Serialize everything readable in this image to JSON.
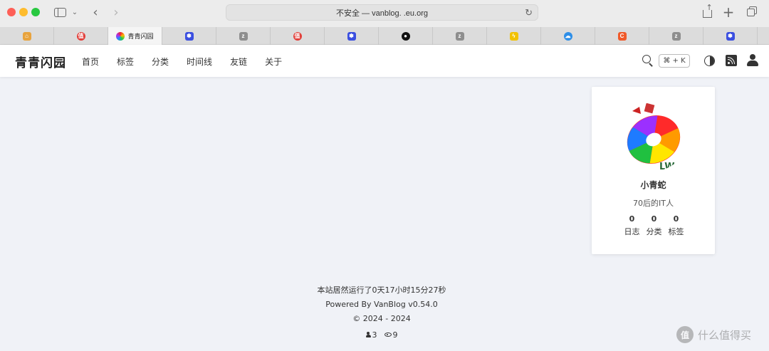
{
  "browser": {
    "url": "不安全 — vanblog.        .eu.org",
    "tabs": [
      {
        "title": "",
        "icon": "home-favicon",
        "color": "#e8a33d"
      },
      {
        "title": "",
        "icon": "smzdm-favicon",
        "color": "#e23f3a"
      },
      {
        "title": "青青闪园",
        "icon": "site-favicon",
        "color": "#6a5acd",
        "active": true
      },
      {
        "title": "",
        "icon": "paw-favicon",
        "color": "#3b4fe0"
      },
      {
        "title": "",
        "icon": "z-favicon",
        "color": "#8e8e8e"
      },
      {
        "title": "",
        "icon": "smzdm-favicon",
        "color": "#e23f3a"
      },
      {
        "title": "",
        "icon": "paw-favicon",
        "color": "#3b4fe0"
      },
      {
        "title": "",
        "icon": "github-favicon",
        "color": "#111111"
      },
      {
        "title": "",
        "icon": "z-favicon",
        "color": "#8e8e8e"
      },
      {
        "title": "",
        "icon": "bolt-favicon",
        "color": "#f2c200"
      },
      {
        "title": "",
        "icon": "cloud-favicon",
        "color": "#2f8fe8"
      },
      {
        "title": "",
        "icon": "c-favicon",
        "color": "#f05a2a"
      },
      {
        "title": "",
        "icon": "z-favicon",
        "color": "#8e8e8e"
      },
      {
        "title": "",
        "icon": "paw-favicon",
        "color": "#3b4fe0"
      }
    ]
  },
  "site": {
    "logo": "青青闪园",
    "nav": [
      "首页",
      "标签",
      "分类",
      "时间线",
      "友链",
      "关于"
    ],
    "search_shortcut": "⌘ + K"
  },
  "profile": {
    "name": "小青蛇",
    "bio": "70后的IT人",
    "stats": [
      {
        "value": "0",
        "label": "日志"
      },
      {
        "value": "0",
        "label": "分类"
      },
      {
        "value": "0",
        "label": "标签"
      }
    ]
  },
  "footer": {
    "uptime": "本站居然运行了0天17小时15分27秒",
    "powered": "Powered By VanBlog v0.54.0",
    "copyright": "© 2024 - 2024",
    "visitors": "3",
    "views": "9"
  },
  "watermark": {
    "badge": "值",
    "text": "什么值得买"
  }
}
